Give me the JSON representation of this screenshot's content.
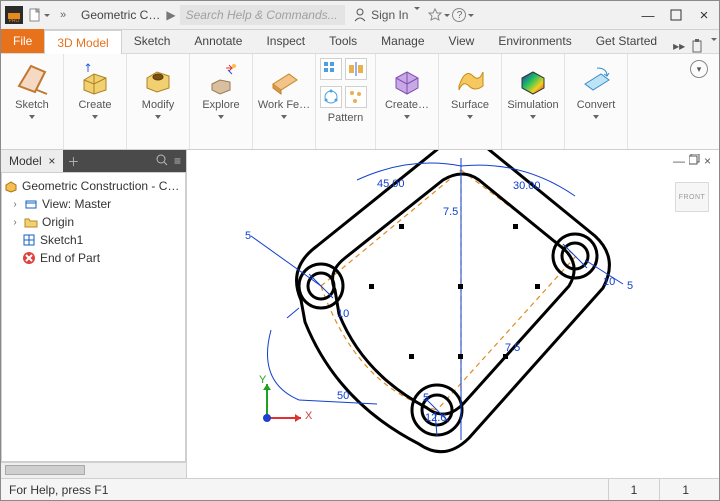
{
  "app": {
    "title": "Geometric C…",
    "search_placeholder": "Search Help & Commands...",
    "sign_in": "Sign In"
  },
  "tabs": {
    "file": "File",
    "items": [
      "3D Model",
      "Sketch",
      "Annotate",
      "Inspect",
      "Tools",
      "Manage",
      "View",
      "Environments",
      "Get Started"
    ],
    "active_index": 0
  },
  "ribbon": {
    "panels": [
      {
        "key": "sketch",
        "label": "Sketch"
      },
      {
        "key": "create",
        "label": "Create"
      },
      {
        "key": "modify",
        "label": "Modify"
      },
      {
        "key": "explore",
        "label": "Explore"
      },
      {
        "key": "workfeatures",
        "label": "Work Fe…"
      },
      {
        "key": "pattern",
        "label": "Pattern"
      },
      {
        "key": "createff",
        "label": "Create…"
      },
      {
        "key": "surface",
        "label": "Surface"
      },
      {
        "key": "simulation",
        "label": "Simulation"
      },
      {
        "key": "convert",
        "label": "Convert"
      }
    ]
  },
  "browser": {
    "tab_label": "Model",
    "root": "Geometric Construction - CAD.ipt",
    "items": [
      {
        "icon": "view",
        "label": "View: Master",
        "expandable": true
      },
      {
        "icon": "folder",
        "label": "Origin",
        "expandable": true
      },
      {
        "icon": "sketch",
        "label": "Sketch1",
        "expandable": false
      },
      {
        "icon": "end",
        "label": "End of Part",
        "expandable": false
      }
    ]
  },
  "dimensions": {
    "d45": "45.00",
    "d30": "30.00",
    "d7_5a": "7.5",
    "d7_5b": "7.5",
    "d5a": "5",
    "d5b": "5",
    "d5c": "5",
    "d10a": "10",
    "d10b": "10",
    "d50": "50",
    "d12_6": "12.6",
    "axis_x": "X",
    "axis_y": "Y"
  },
  "viewcube": "FRONT",
  "status": {
    "help": "For Help, press F1",
    "c1": "1",
    "c2": "1"
  }
}
